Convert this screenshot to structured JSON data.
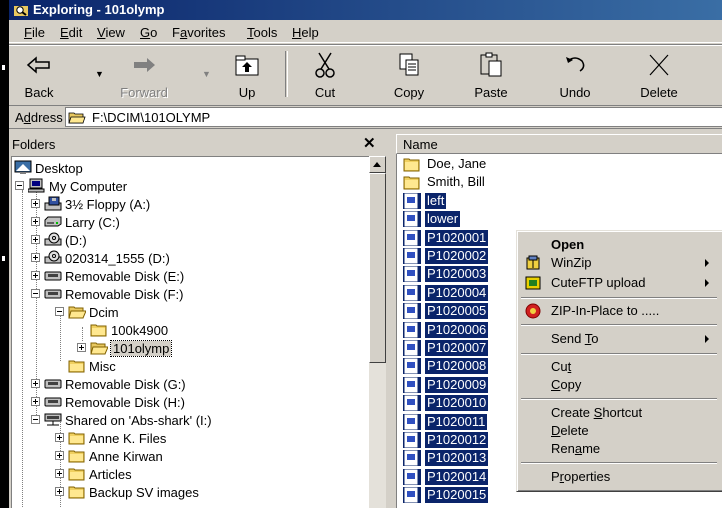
{
  "window": {
    "title": "Exploring - 101olymp"
  },
  "menu": {
    "items": [
      "File",
      "Edit",
      "View",
      "Go",
      "Favorites",
      "Tools",
      "Help"
    ]
  },
  "toolbar": {
    "buttons": [
      {
        "label": "Back",
        "icon": "back-arrow-icon",
        "enabled": true
      },
      {
        "label": "Forward",
        "icon": "forward-arrow-icon",
        "enabled": false
      },
      {
        "label": "Up",
        "icon": "up-folder-icon",
        "enabled": true
      },
      {
        "label": "Cut",
        "icon": "scissors-icon",
        "enabled": true
      },
      {
        "label": "Copy",
        "icon": "copy-icon",
        "enabled": true
      },
      {
        "label": "Paste",
        "icon": "paste-icon",
        "enabled": true
      },
      {
        "label": "Undo",
        "icon": "undo-icon",
        "enabled": true
      },
      {
        "label": "Delete",
        "icon": "delete-x-icon",
        "enabled": true
      }
    ]
  },
  "address": {
    "label": "Address",
    "value": "F:\\DCIM\\101OLYMP"
  },
  "folders": {
    "title": "Folders",
    "close": "✕",
    "nodes": [
      {
        "label": "Desktop",
        "icon": "desktop-icon"
      },
      {
        "label": "My Computer",
        "icon": "computer-icon"
      },
      {
        "label": "3½ Floppy (A:)",
        "icon": "floppy-icon"
      },
      {
        "label": "Larry (C:)",
        "icon": "hard-drive-icon"
      },
      {
        "label": "(D:)",
        "icon": "cd-drive-icon"
      },
      {
        "label": "020314_1555 (D:)",
        "icon": "cd-drive-icon"
      },
      {
        "label": "Removable Disk (E:)",
        "icon": "removable-disk-icon"
      },
      {
        "label": "Removable Disk (F:)",
        "icon": "removable-disk-icon"
      },
      {
        "label": "Dcim",
        "icon": "open-folder-icon"
      },
      {
        "label": "100k4900",
        "icon": "folder-icon"
      },
      {
        "label": "101olymp",
        "icon": "open-folder-icon"
      },
      {
        "label": "Misc",
        "icon": "folder-icon"
      },
      {
        "label": "Removable Disk (G:)",
        "icon": "removable-disk-icon"
      },
      {
        "label": "Removable Disk (H:)",
        "icon": "removable-disk-icon"
      },
      {
        "label": "Shared on 'Abs-shark' (I:)",
        "icon": "network-drive-icon"
      },
      {
        "label": "Anne K. Files",
        "icon": "folder-icon"
      },
      {
        "label": "Anne Kirwan",
        "icon": "folder-icon"
      },
      {
        "label": "Articles",
        "icon": "folder-icon"
      },
      {
        "label": "Backup SV images",
        "icon": "folder-icon"
      }
    ]
  },
  "files": {
    "column": "Name",
    "items": [
      {
        "name": "Doe, Jane",
        "type": "folder"
      },
      {
        "name": "Smith, Bill",
        "type": "folder"
      },
      {
        "name": "left",
        "type": "image"
      },
      {
        "name": "lower",
        "type": "image"
      },
      {
        "name": "P1020001",
        "type": "image"
      },
      {
        "name": "P1020002",
        "type": "image"
      },
      {
        "name": "P1020003",
        "type": "image"
      },
      {
        "name": "P1020004",
        "type": "image"
      },
      {
        "name": "P1020005",
        "type": "image"
      },
      {
        "name": "P1020006",
        "type": "image"
      },
      {
        "name": "P1020007",
        "type": "image"
      },
      {
        "name": "P1020008",
        "type": "image"
      },
      {
        "name": "P1020009",
        "type": "image"
      },
      {
        "name": "P1020010",
        "type": "image"
      },
      {
        "name": "P1020011",
        "type": "image"
      },
      {
        "name": "P1020012",
        "type": "image"
      },
      {
        "name": "P1020013",
        "type": "image"
      },
      {
        "name": "P1020014",
        "type": "image"
      },
      {
        "name": "P1020015",
        "type": "image"
      }
    ]
  },
  "context_menu": {
    "items": [
      {
        "label": "Open",
        "bold": true
      },
      {
        "label": "WinZip",
        "submenu": true,
        "icon": "winzip-icon"
      },
      {
        "label": "CuteFTP upload",
        "submenu": true,
        "icon": "cuteftp-icon"
      },
      {
        "label": "ZIP-In-Place to .....",
        "icon": "zip-in-place-icon"
      },
      {
        "label": "Send To",
        "submenu": true
      },
      {
        "label": "Cut"
      },
      {
        "label": "Copy"
      },
      {
        "label": "Create Shortcut"
      },
      {
        "label": "Delete"
      },
      {
        "label": "Rename"
      },
      {
        "label": "Properties"
      }
    ]
  },
  "colors": {
    "selection": "#0a246a",
    "title_gradient_start": "#0a246a",
    "title_gradient_end": "#3a6ea5",
    "face": "#d4d0c8"
  }
}
